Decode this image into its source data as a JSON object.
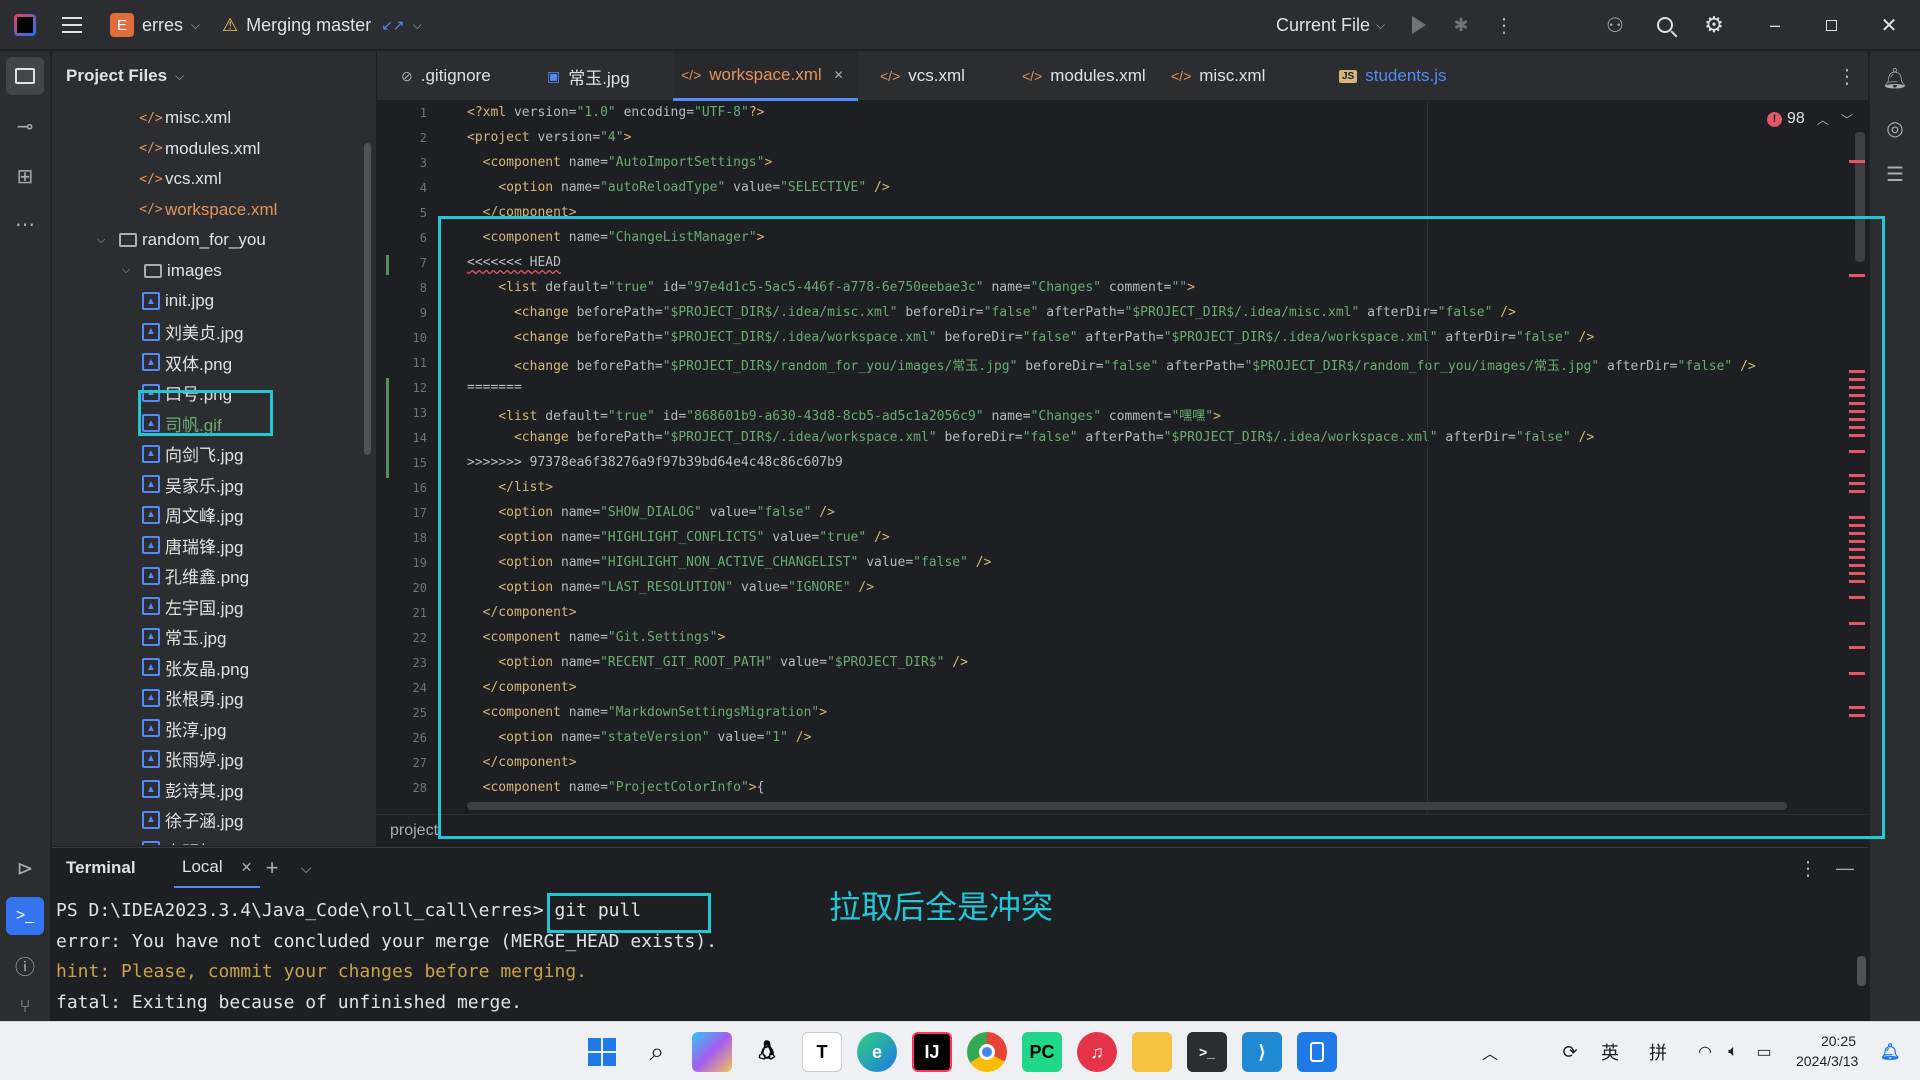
{
  "titlebar": {
    "project_badge": "E",
    "project_name": "erres",
    "branch": "Merging master",
    "branch_arrows": "↙↗",
    "run_config": "Current File"
  },
  "project_panel": {
    "title": "Project Files",
    "items": [
      {
        "label": "misc.xml",
        "type": "xml",
        "color": "#dfe1e5"
      },
      {
        "label": "modules.xml",
        "type": "xml",
        "color": "#dfe1e5"
      },
      {
        "label": "vcs.xml",
        "type": "xml",
        "color": "#dfe1e5"
      },
      {
        "label": "workspace.xml",
        "type": "xml",
        "color": "#e6935c"
      },
      {
        "label": "random_for_you",
        "type": "folder",
        "color": "#dfe1e5"
      },
      {
        "label": "images",
        "type": "folder",
        "color": "#dfe1e5"
      },
      {
        "label": "init.jpg",
        "type": "image",
        "color": "#dfe1e5"
      },
      {
        "label": "刘美贞.jpg",
        "type": "image",
        "color": "#dfe1e5"
      },
      {
        "label": "双体.png",
        "type": "image",
        "color": "#dfe1e5"
      },
      {
        "label": "口号.png",
        "type": "image",
        "color": "#dfe1e5"
      },
      {
        "label": "司帆.gif",
        "type": "image",
        "color": "#6aab73"
      },
      {
        "label": "向剑飞.jpg",
        "type": "image",
        "color": "#dfe1e5"
      },
      {
        "label": "吴家乐.jpg",
        "type": "image",
        "color": "#dfe1e5"
      },
      {
        "label": "周文峰.jpg",
        "type": "image",
        "color": "#dfe1e5"
      },
      {
        "label": "唐瑞锋.jpg",
        "type": "image",
        "color": "#dfe1e5"
      },
      {
        "label": "孔维鑫.png",
        "type": "image",
        "color": "#dfe1e5"
      },
      {
        "label": "左宇国.jpg",
        "type": "image",
        "color": "#dfe1e5"
      },
      {
        "label": "常玉.jpg",
        "type": "image",
        "color": "#dfe1e5"
      },
      {
        "label": "张友晶.png",
        "type": "image",
        "color": "#dfe1e5"
      },
      {
        "label": "张根勇.jpg",
        "type": "image",
        "color": "#dfe1e5"
      },
      {
        "label": "张淳.jpg",
        "type": "image",
        "color": "#dfe1e5"
      },
      {
        "label": "张雨婷.jpg",
        "type": "image",
        "color": "#dfe1e5"
      },
      {
        "label": "彭诗其.jpg",
        "type": "image",
        "color": "#dfe1e5"
      },
      {
        "label": "徐子涵.jpg",
        "type": "image",
        "color": "#dfe1e5"
      },
      {
        "label": "李明权.jpg",
        "type": "image",
        "color": "#dfe1e5"
      }
    ]
  },
  "tabs": [
    {
      "label": ".gitignore",
      "icon": "⊘",
      "active": false
    },
    {
      "label": "常玉.jpg",
      "icon": "▣",
      "active": false
    },
    {
      "label": "workspace.xml",
      "icon": "</>",
      "active": true
    },
    {
      "label": "vcs.xml",
      "icon": "</>",
      "active": false
    },
    {
      "label": "modules.xml",
      "icon": "</>",
      "active": false
    },
    {
      "label": "misc.xml",
      "icon": "</>",
      "active": false
    },
    {
      "label": "students.js",
      "icon": "JS",
      "active": false
    }
  ],
  "editor": {
    "problems_count": "98",
    "breadcrumb": "project",
    "lines": [
      "<?xml version=\"1.0\" encoding=\"UTF-8\"?>",
      "<project version=\"4\">",
      "  <component name=\"AutoImportSettings\">",
      "    <option name=\"autoReloadType\" value=\"SELECTIVE\" />",
      "  </component>",
      "  <component name=\"ChangeListManager\">",
      "<<<<<<< HEAD",
      "    <list default=\"true\" id=\"97e4d1c5-5ac5-446f-a778-6e750eebae3c\" name=\"Changes\" comment=\"\">",
      "      <change beforePath=\"$PROJECT_DIR$/.idea/misc.xml\" beforeDir=\"false\" afterPath=\"$PROJECT_DIR$/.idea/misc.xml\" afterDir=\"false\" />",
      "      <change beforePath=\"$PROJECT_DIR$/.idea/workspace.xml\" beforeDir=\"false\" afterPath=\"$PROJECT_DIR$/.idea/workspace.xml\" afterDir=\"false\" />",
      "      <change beforePath=\"$PROJECT_DIR$/random_for_you/images/常玉.jpg\" beforeDir=\"false\" afterPath=\"$PROJECT_DIR$/random_for_you/images/常玉.jpg\" afterDir=\"false\" />",
      "=======",
      "    <list default=\"true\" id=\"868601b9-a630-43d8-8cb5-ad5c1a2056c9\" name=\"Changes\" comment=\"嘿嘿\">",
      "      <change beforePath=\"$PROJECT_DIR$/.idea/workspace.xml\" beforeDir=\"false\" afterPath=\"$PROJECT_DIR$/.idea/workspace.xml\" afterDir=\"false\" />",
      ">>>>>>> 97378ea6f38276a9f97b39bd64e4c48c86c607b9",
      "    </list>",
      "    <option name=\"SHOW_DIALOG\" value=\"false\" />",
      "    <option name=\"HIGHLIGHT_CONFLICTS\" value=\"true\" />",
      "    <option name=\"HIGHLIGHT_NON_ACTIVE_CHANGELIST\" value=\"false\" />",
      "    <option name=\"LAST_RESOLUTION\" value=\"IGNORE\" />",
      "  </component>",
      "  <component name=\"Git.Settings\">",
      "    <option name=\"RECENT_GIT_ROOT_PATH\" value=\"$PROJECT_DIR$\" />",
      "  </component>",
      "  <component name=\"MarkdownSettingsMigration\">",
      "    <option name=\"stateVersion\" value=\"1\" />",
      "  </component>",
      "  <component name=\"ProjectColorInfo\">{"
    ]
  },
  "terminal": {
    "title": "Terminal",
    "tab": "Local",
    "lines": [
      {
        "text": "PS D:\\IDEA2023.3.4\\Java_Code\\roll_call\\erres> git pull",
        "color": "#dfe1e5"
      },
      {
        "text": "error: You have not concluded your merge (MERGE_HEAD exists).",
        "color": "#dfe1e5"
      },
      {
        "text": "hint: Please, commit your changes before merging.",
        "color": "#c9a34a"
      },
      {
        "text": "fatal: Exiting because of unfinished merge.",
        "color": "#dfe1e5"
      }
    ]
  },
  "annotation": {
    "text": "拉取后全是冲突"
  },
  "taskbar": {
    "ime_lang": "英",
    "ime_mode": "拼",
    "time": "20:25",
    "date": "2024/3/13"
  },
  "colors": {
    "highlight_box": "#22c7d6",
    "accent": "#548af7",
    "conflict_mark": "#e5566a"
  }
}
